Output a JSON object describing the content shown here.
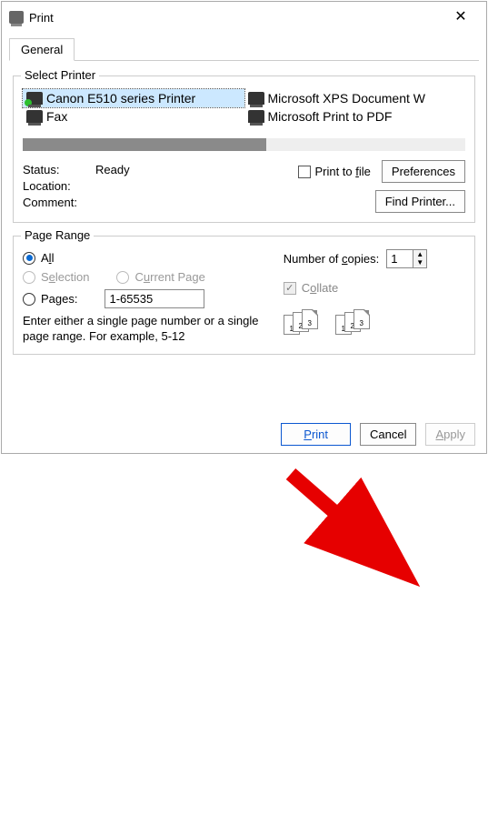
{
  "title": "Print",
  "tabs": {
    "general": "General"
  },
  "select_printer": {
    "legend": "Select Printer",
    "printers": [
      {
        "name": "Canon E510 series Printer",
        "selected": true
      },
      {
        "name": "Microsoft XPS Document W"
      },
      {
        "name": "Fax"
      },
      {
        "name": "Microsoft Print to PDF"
      }
    ],
    "status_label": "Status:",
    "status_value": "Ready",
    "location_label": "Location:",
    "comment_label": "Comment:",
    "print_to_file": "Print to file",
    "preferences_btn": "Preferences",
    "find_printer_btn": "Find Printer..."
  },
  "page_range": {
    "legend": "Page Range",
    "all": "All",
    "selection": "Selection",
    "current_page": "Current Page",
    "pages": "Pages:",
    "pages_value": "1-65535",
    "hint": "Enter either a single page number or a single page range.  For example, 5-12",
    "copies_label": "Number of copies:",
    "copies_value": "1",
    "collate": "Collate"
  },
  "footer": {
    "print": "Print",
    "cancel": "Cancel",
    "apply": "Apply"
  },
  "annotation": {
    "arrow_color": "#e60000",
    "from": [
      325,
      130
    ],
    "to": [
      420,
      205
    ]
  }
}
